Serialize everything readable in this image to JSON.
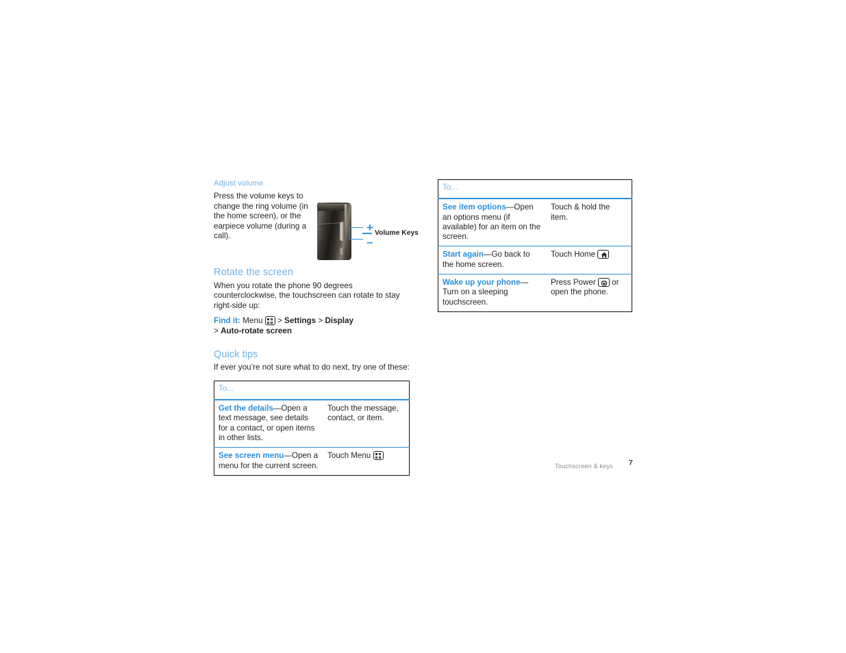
{
  "document": {
    "footer": {
      "chapter": "Touchscreen & keys",
      "page_number": "7"
    }
  },
  "left_column": {
    "adjust_volume": {
      "heading": "Adjust volume",
      "body": "Press the volume keys to change the ring volume (in the home screen), or the earpiece volume (during a call)."
    },
    "phone_figure": {
      "callout_label": "Volume Keys",
      "plus_sign": "+",
      "minus_sign": "–"
    },
    "rotate_the_screen": {
      "heading": "Rotate the screen",
      "body": "When you rotate the phone 90 degrees counterclockwise, the touchscreen can rotate to stay right-side up:",
      "find_it": {
        "label": "Find it:",
        "menu_word": "Menu",
        "sep1": ">",
        "item1": "Settings",
        "sep2": ">",
        "item2": "Display",
        "sep3": ">",
        "item3": "Auto-rotate screen"
      }
    },
    "quick_tips": {
      "heading": "Quick tips",
      "body": "If ever you’re not sure what to do next, try one of these:",
      "table": {
        "header": "To...",
        "rows": [
          {
            "term": "Get the details",
            "description": "—Open a text message, see details for a contact, or open items in other lists.",
            "action": "Touch the message, contact, or item.",
            "action_icon": ""
          },
          {
            "term": "See screen menu",
            "description": "—Open a menu for the current screen.",
            "action": "Touch Menu",
            "action_icon": "menu-key-icon"
          }
        ]
      }
    }
  },
  "right_column": {
    "table": {
      "header": "To...",
      "rows": [
        {
          "term": "See item options",
          "description": "—Open an options menu (if available) for an item on the screen.",
          "action": "Touch & hold the item.",
          "action_icon": ""
        },
        {
          "term": "Start again",
          "description": "—Go back to the home screen.",
          "action": "Touch Home",
          "action_icon": "home-key-icon"
        },
        {
          "term": "Wake up your phone",
          "description": "—Turn on a sleeping touchscreen.",
          "action_pre": "Press Power",
          "action_icon": "power-key-icon",
          "action_post": "or open the phone."
        }
      ]
    }
  },
  "colors": {
    "heading_blue": "#6fb2e5",
    "accent_blue": "#2d8fd8",
    "table_header_blue": "#7cb8e8",
    "body_text": "#231f20",
    "footer_gray": "#8d8d8d"
  }
}
